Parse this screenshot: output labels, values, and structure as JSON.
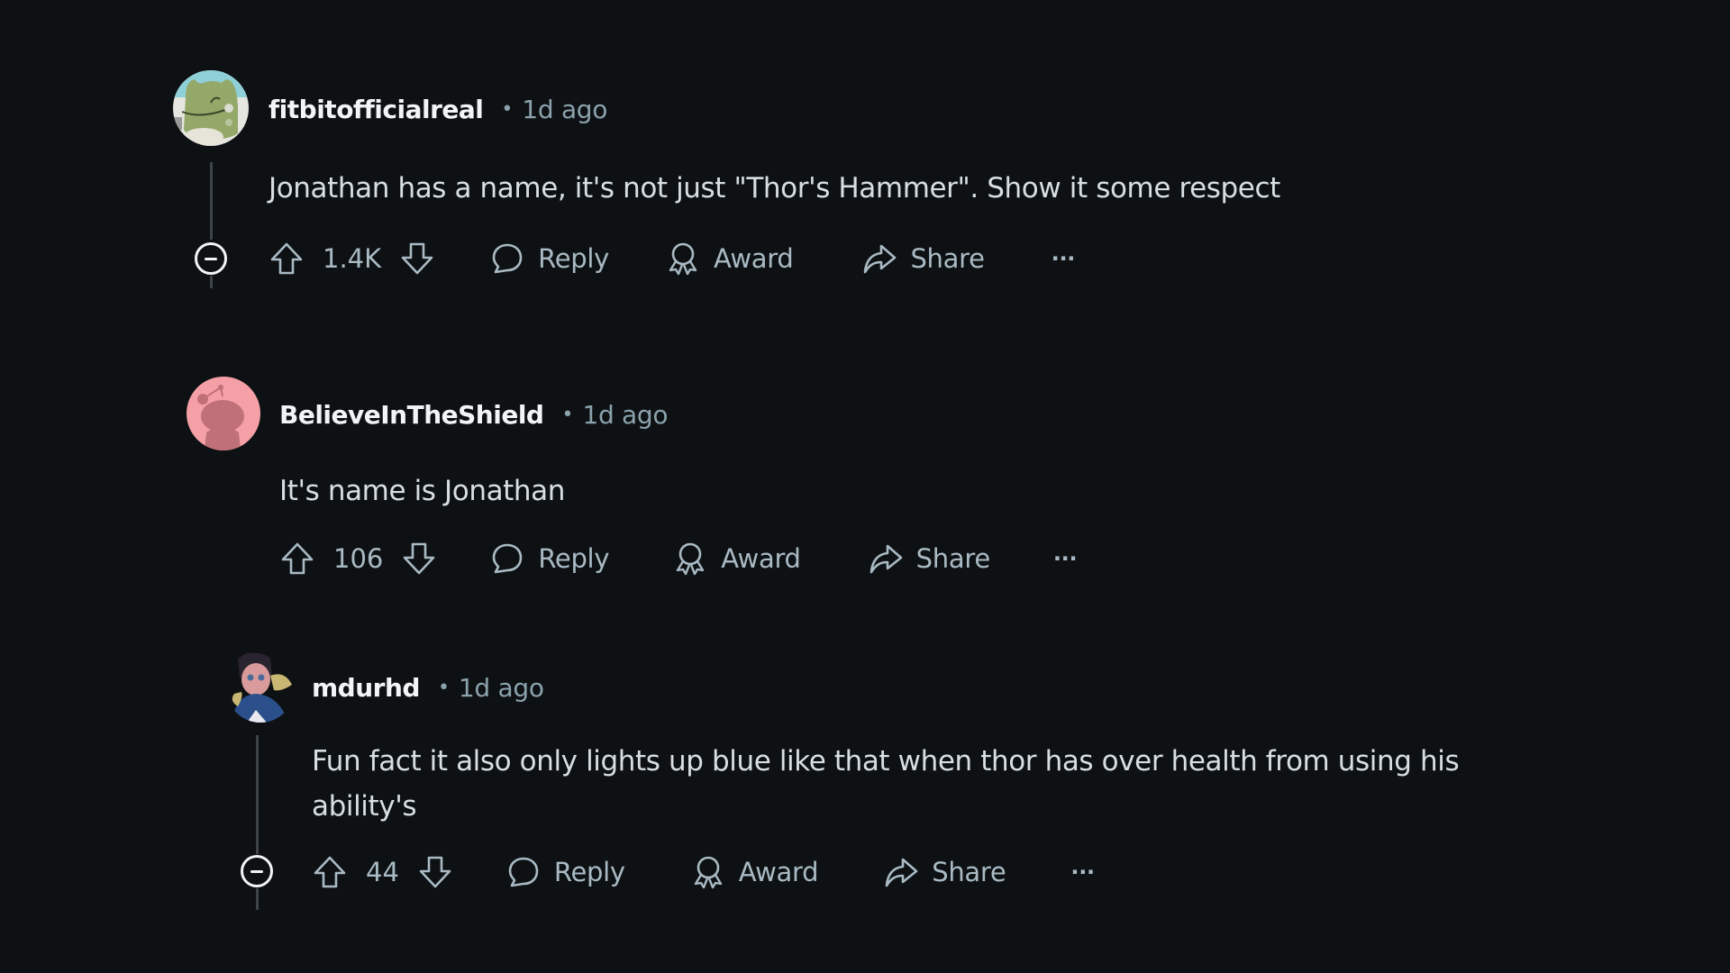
{
  "colors": {
    "background": "#0e1113",
    "username": "#f2f4f5",
    "meta": "#8ba2ad",
    "body_text": "#d7dfe4",
    "action_text": "#a9bac4",
    "threadline": "#3e4449"
  },
  "comments": [
    {
      "username": "fitbitofficialreal",
      "separator": "•",
      "time": "1d ago",
      "avatar": "frog-avatar",
      "body": [
        "Jonathan has a name, it's not just \"Thor's Hammer\". Show it some respect"
      ],
      "score": "1.4K",
      "actions": {
        "reply": "Reply",
        "award": "Award",
        "share": "Share",
        "more": "···"
      },
      "collapsible": true
    },
    {
      "username": "BelieveInTheShield",
      "separator": "•",
      "time": "1d ago",
      "avatar": "snoo-default-avatar",
      "body": [
        "It's name is Jonathan"
      ],
      "score": "106",
      "actions": {
        "reply": "Reply",
        "award": "Award",
        "share": "Share",
        "more": "···"
      },
      "collapsible": false
    },
    {
      "username": "mdurhd",
      "separator": "•",
      "time": "1d ago",
      "avatar": "anime-character-avatar",
      "body": [
        "Fun fact it also only lights up blue like that when thor has over health from using his",
        "ability's"
      ],
      "score": "44",
      "actions": {
        "reply": "Reply",
        "award": "Award",
        "share": "Share",
        "more": "···"
      },
      "collapsible": true
    }
  ]
}
